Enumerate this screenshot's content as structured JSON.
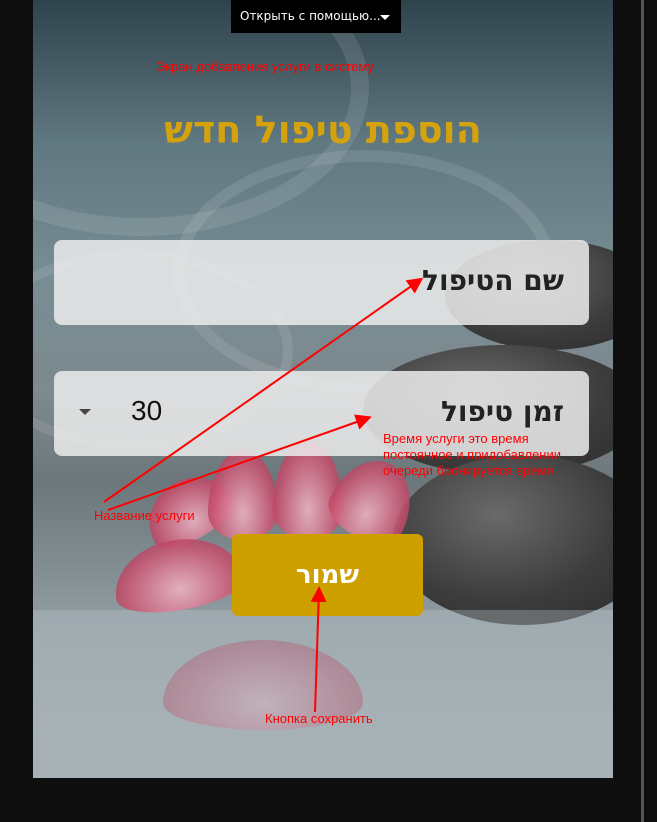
{
  "toolbar": {
    "open_with_label": "Открыть с помощью..."
  },
  "annotations": {
    "screen_caption": "Экран добавления услуги в систему",
    "service_name_caption": "Название услуги",
    "duration_caption_line1": "Время услуги это время",
    "duration_caption_line2": "постоянное и придобавлении",
    "duration_caption_line3": "очереди бронируется время",
    "save_caption": "Кнопка сохранить",
    "color": "#ff0000"
  },
  "form": {
    "title": "הוספת טיפול חדש",
    "name_field": {
      "placeholder": "שם הטיפול"
    },
    "duration_field": {
      "label": "זמן טיפול",
      "value": "30"
    },
    "save_label": "שמור"
  },
  "colors": {
    "accent_gold": "#cda000",
    "title_gold": "#d4a20c",
    "field_background": "#ebebeb"
  }
}
